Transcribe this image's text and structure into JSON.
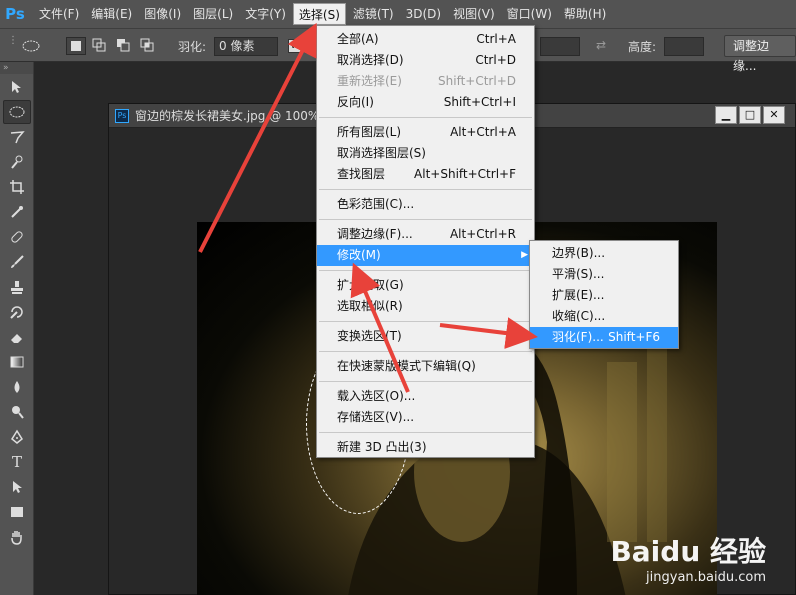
{
  "app": {
    "logo": "Ps"
  },
  "menubar": {
    "items": [
      "文件(F)",
      "编辑(E)",
      "图像(I)",
      "图层(L)",
      "文字(Y)",
      "选择(S)",
      "滤镜(T)",
      "3D(D)",
      "视图(V)",
      "窗口(W)",
      "帮助(H)"
    ],
    "active_index": 5
  },
  "options": {
    "feather_label": "羽化:",
    "feather_value": "0 像素",
    "height_label": "高度:",
    "refine_edge_button": "调整边缘..."
  },
  "document": {
    "title": "窗边的棕发长裙美女.jpg @ 100%",
    "minimize": "▁",
    "restore": "□",
    "close": "✕"
  },
  "select_menu": {
    "items": [
      {
        "label": "全部(A)",
        "shortcut": "Ctrl+A"
      },
      {
        "label": "取消选择(D)",
        "shortcut": "Ctrl+D"
      },
      {
        "label": "重新选择(E)",
        "shortcut": "Shift+Ctrl+D",
        "disabled": true
      },
      {
        "label": "反向(I)",
        "shortcut": "Shift+Ctrl+I"
      },
      {
        "label": "所有图层(L)",
        "shortcut": "Alt+Ctrl+A"
      },
      {
        "label": "取消选择图层(S)",
        "shortcut": ""
      },
      {
        "label": "查找图层",
        "shortcut": "Alt+Shift+Ctrl+F"
      },
      {
        "label": "色彩范围(C)...",
        "shortcut": ""
      },
      {
        "label": "调整边缘(F)...",
        "shortcut": "Alt+Ctrl+R"
      },
      {
        "label": "修改(M)",
        "shortcut": "",
        "submenu": true,
        "highlight": true
      },
      {
        "label": "扩大选取(G)",
        "shortcut": ""
      },
      {
        "label": "选取相似(R)",
        "shortcut": ""
      },
      {
        "label": "变换选区(T)",
        "shortcut": ""
      },
      {
        "label": "在快速蒙版模式下编辑(Q)",
        "shortcut": ""
      },
      {
        "label": "载入选区(O)...",
        "shortcut": ""
      },
      {
        "label": "存储选区(V)...",
        "shortcut": ""
      },
      {
        "label": "新建 3D 凸出(3)",
        "shortcut": ""
      }
    ]
  },
  "modify_submenu": {
    "items": [
      {
        "label": "边界(B)...",
        "shortcut": ""
      },
      {
        "label": "平滑(S)...",
        "shortcut": ""
      },
      {
        "label": "扩展(E)...",
        "shortcut": ""
      },
      {
        "label": "收缩(C)...",
        "shortcut": ""
      },
      {
        "label": "羽化(F)...",
        "shortcut": "Shift+F6",
        "highlight": true
      }
    ]
  },
  "watermark": {
    "logo": "Baidu 经验",
    "url": "jingyan.baidu.com"
  },
  "colors": {
    "menu_highlight": "#3399ff",
    "annotation_arrow": "#e8423a",
    "ps_blue": "#31a8ff"
  }
}
